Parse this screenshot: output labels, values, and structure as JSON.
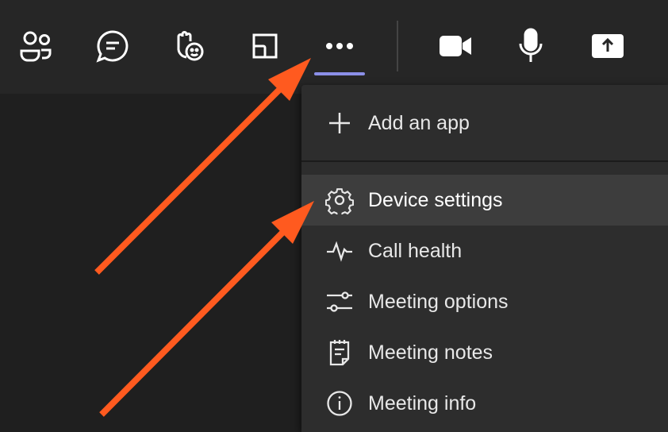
{
  "toolbar": {
    "buttons": [
      {
        "name": "people",
        "icon": "people-icon"
      },
      {
        "name": "chat",
        "icon": "chat-icon"
      },
      {
        "name": "react",
        "icon": "raise-hand-react-icon"
      },
      {
        "name": "rooms",
        "icon": "breakout-rooms-icon"
      },
      {
        "name": "more",
        "icon": "more-actions-icon",
        "active": true
      },
      {
        "name": "camera",
        "icon": "camera-icon"
      },
      {
        "name": "mic",
        "icon": "microphone-icon"
      },
      {
        "name": "share",
        "icon": "share-screen-icon"
      }
    ],
    "active_indicator_color": "#8b8fe8"
  },
  "menu": {
    "items": [
      {
        "label": "Add an app",
        "icon": "plus-icon"
      },
      {
        "label": "Device settings",
        "icon": "gear-icon",
        "selected": true
      },
      {
        "label": "Call health",
        "icon": "pulse-icon"
      },
      {
        "label": "Meeting options",
        "icon": "sliders-icon"
      },
      {
        "label": "Meeting notes",
        "icon": "notes-icon"
      },
      {
        "label": "Meeting info",
        "icon": "info-icon"
      }
    ]
  },
  "annotations": {
    "arrow_color": "#ff5a1f"
  }
}
